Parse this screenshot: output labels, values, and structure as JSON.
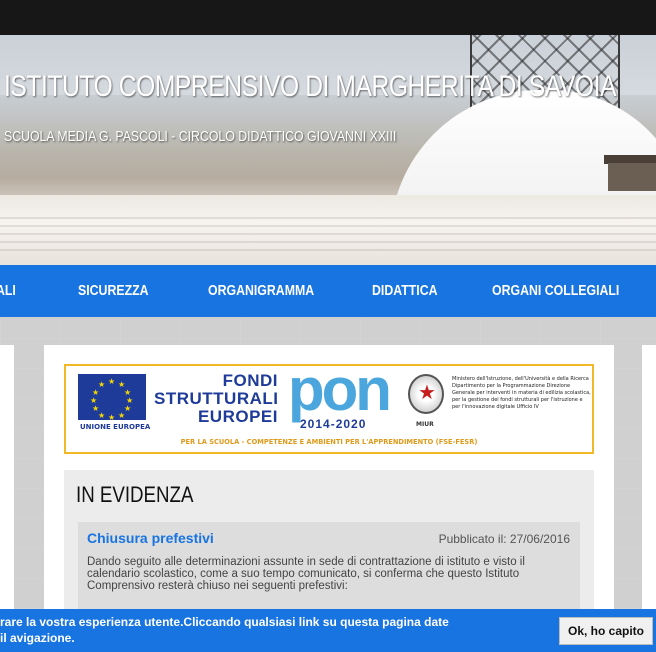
{
  "site": {
    "title": "ISTITUTO COMPRENSIVO DI MARGHERITA DI SAVOIA",
    "subtitle": "SCUOLA MEDIA G. PASCOLI - CIRCOLO DIDATTICO GIOVANNI XXIII"
  },
  "nav": {
    "items": [
      {
        "label": "ALI"
      },
      {
        "label": "SICUREZZA"
      },
      {
        "label": "ORGANIGRAMMA"
      },
      {
        "label": "DIDATTICA"
      },
      {
        "label": "ORGANI COLLEGIALI"
      }
    ]
  },
  "banner": {
    "eu_label": "UNIONE EUROPEA",
    "fondi_line1": "FONDI",
    "fondi_line2": "STRUTTURALI",
    "fondi_line3": "EUROPEI",
    "pon_word": "pon",
    "pon_years": "2014-2020",
    "miur_label": "MIUR",
    "ministry_text": "Ministero dell'Istruzione, dell'Università e della Ricerca Dipartimento per la Programmazione Direzione Generale per interventi in materia di edilizia scolastica, per la gestione dei fondi strutturali per l'istruzione e per l'innovazione digitale Ufficio IV",
    "footer": "PER LA SCUOLA - COMPETENZE E AMBIENTI PER L'APPRENDIMENTO (FSE-FESR)"
  },
  "evidenza": {
    "title": "IN EVIDENZA",
    "news": {
      "title": "Chiusura prefestivi",
      "date": "Pubblicato il: 27/06/2016",
      "text": "Dando seguito alle determinazioni assunte in sede di contrattazione di istituto e visto il calendario scolastico, come a suo tempo comunicato, si conferma che questo Istituto Comprensivo resterà chiuso nei seguenti prefestivi:"
    }
  },
  "cookie": {
    "text": "rare la vostra esperienza utente.Cliccando qualsiasi link su questa pagina date il avigazione.",
    "button_label": "Ok, ho capito"
  },
  "colors": {
    "accent": "#1874e0",
    "topbar": "#171717",
    "banner_border": "#f2b826",
    "eu_blue": "#1f3b9a",
    "pon_blue": "#4aa6dc"
  }
}
